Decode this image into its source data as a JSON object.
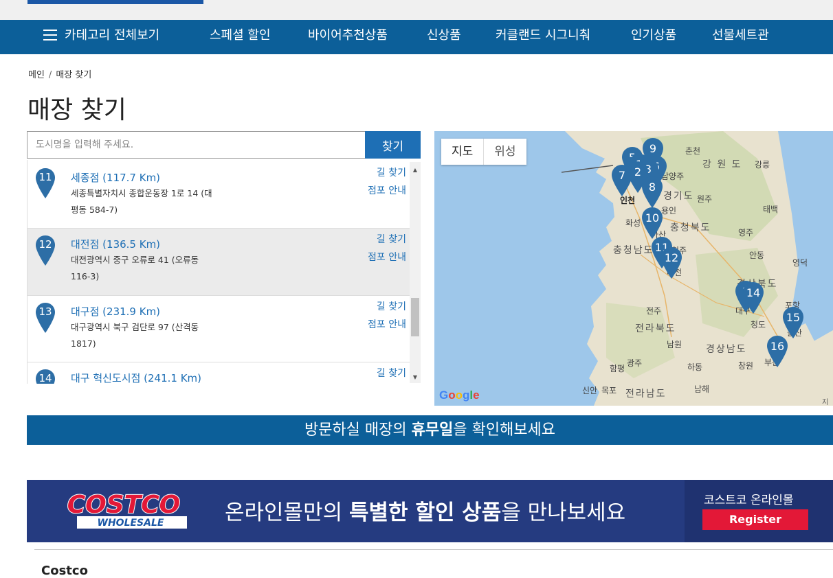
{
  "nav": {
    "menu_icon": "hamburger-icon",
    "items": [
      "카테고리 전체보기",
      "스페셜 할인",
      "바이어추천상품",
      "신상품",
      "커클랜드 시그니춰",
      "인기상품",
      "선물세트관"
    ]
  },
  "breadcrumb": {
    "home": "메인",
    "separator": "/",
    "current": "매장 찾기"
  },
  "page_title": "매장 찾기",
  "search": {
    "placeholder": "도시명을 입력해 주세요.",
    "value": "",
    "button": "찾기"
  },
  "stores": [
    {
      "num": "11",
      "name": "세종점 (117.7 Km)",
      "addr": "세종특별자치시 종합운동장 1로 14 (대평동 584-7)",
      "link1": "길 찾기",
      "link2": "점포 안내"
    },
    {
      "num": "12",
      "name": "대전점 (136.5 Km)",
      "addr": "대전광역시 중구 오류로 41 (오류동 116-3)",
      "link1": "길 찾기",
      "link2": "점포 안내"
    },
    {
      "num": "13",
      "name": "대구점 (231.9 Km)",
      "addr": "대구광역시 북구 검단로 97 (산격동 1817)",
      "link1": "길 찾기",
      "link2": "점포 안내"
    },
    {
      "num": "14",
      "name": "대구 혁신도시점 (241.1 Km)",
      "addr": "",
      "link1": "길 찾기",
      "link2": ""
    }
  ],
  "map": {
    "tab_map": "지도",
    "tab_satellite": "위성",
    "google": "Google",
    "copyright": "지도",
    "pins": [
      "9",
      "5",
      "1",
      "3",
      "6",
      "2",
      "7",
      "8",
      "10",
      "11",
      "12",
      "1",
      "14",
      "15",
      "16"
    ],
    "labels": {
      "chuncheon": "춘천",
      "gangwon": "강 원 도",
      "gangneung": "강릉",
      "namyangju": "남양주",
      "gyeonggi": "경기도",
      "wonju": "원주",
      "incheon": "인천",
      "yongin": "용인",
      "taebaek": "태백",
      "hwaseong": "화성",
      "chungbuk": "충청북도",
      "yeongju": "영주",
      "asan": "아산",
      "chungnam": "충청남도",
      "cheongju": "청주",
      "andong": "안동",
      "yeongdeok": "영덕",
      "daejeon": "대전",
      "gyeongbuk": "경상북도",
      "pohang": "포항",
      "jeonju": "전주",
      "daegu": "대구",
      "jeonbuk": "전라북도",
      "cheongdo": "청도",
      "ulsan": "울산",
      "namwon": "남원",
      "gyeongnam": "경상남도",
      "gwangju": "광주",
      "haman": "하동",
      "changwon": "창원",
      "hampyeong": "함평",
      "busan": "부산",
      "sinan": "신안",
      "mokpo": "목포",
      "jeonnam": "전라남도",
      "namhae": "남해"
    },
    "accent": "#2d6ea6"
  },
  "holiday_banner": {
    "pre": "방문하실 매장의 ",
    "bold": "휴무일",
    "post": "을 확인해보세요"
  },
  "promo": {
    "logo_top": "COSTCO",
    "logo_bottom": "WHOLESALE",
    "text_pre": "온라인몰만의 ",
    "text_bold": "특별한 할인 상품",
    "text_post": "을 만나보세요",
    "online_label": "코스트코 온라인몰",
    "register": "Register"
  },
  "footer_peek": "Costco"
}
